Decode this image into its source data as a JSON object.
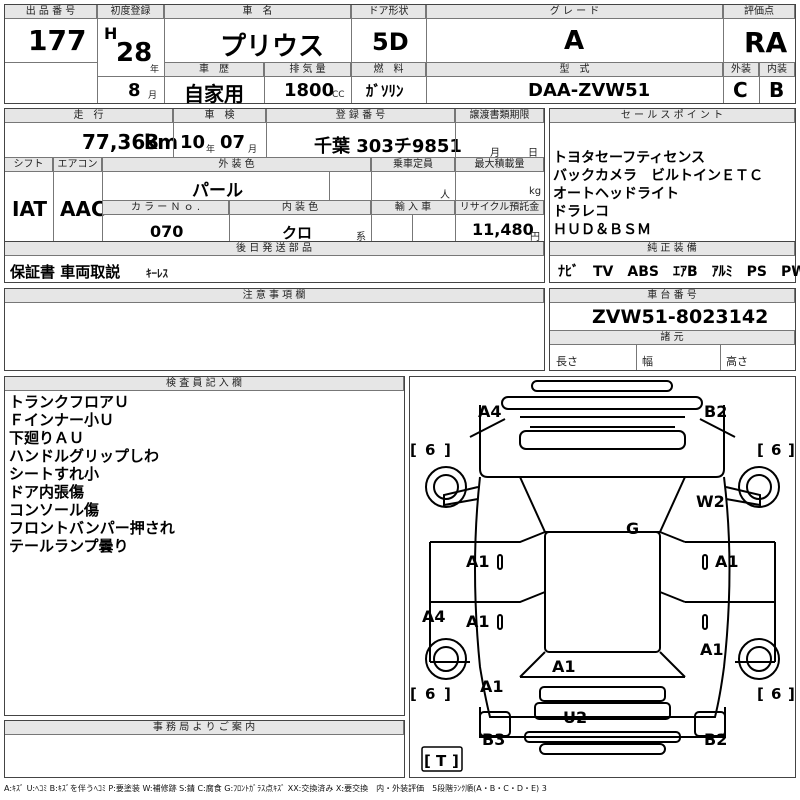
{
  "header": {
    "lot_no_label": "出 品 番 号",
    "lot_no": "177",
    "first_reg_label": "初度登録",
    "era": "H",
    "year": "28",
    "year_unit": "年",
    "month": "8",
    "month_unit": "月",
    "car_name_label": "車　名",
    "car_name": "プリウス",
    "door_label": "ドア形状",
    "door": "5D",
    "grade_label": "グ レ ー ド",
    "grade": "A",
    "score_label": "評価点",
    "score": "RA",
    "history_label": "車　歴",
    "history": "自家用",
    "displacement_label": "排 気 量",
    "displacement": "1800",
    "displacement_unit": "CC",
    "fuel_label": "燃　料",
    "fuel": "ｶﾞｿﾘﾝ",
    "model_label": "型　式",
    "model": "DAA-ZVW51",
    "exterior_label": "外装",
    "exterior": "C",
    "interior_label": "内装",
    "interior": "B"
  },
  "row2": {
    "mileage_label": "走　行",
    "mileage": "77,363",
    "mileage_unit": "km",
    "inspection_label": "車　検",
    "insp_year": "10",
    "insp_year_unit": "年",
    "insp_month": "07",
    "insp_month_unit": "月",
    "plate_label": "登 録 番 号",
    "plate": "千葉 303チ9851",
    "transfer_label": "譲渡書類期限",
    "transfer_month": "月",
    "transfer_day": "日",
    "shift_label": "シフト",
    "shift": "IAT",
    "ac_label": "エアコン",
    "ac": "AAC",
    "color_label": "外 装 色",
    "color": "パール",
    "capacity_label": "乗車定員",
    "capacity_unit": "人",
    "loadcap_label": "最大積載量",
    "loadcap_unit": "kg",
    "colorno_label": "カ ラ ー Ｎ ｏ .",
    "colorno": "070",
    "intcolor_label": "内 装 色",
    "intcolor": "クロ",
    "intcolor_unit": "系",
    "import_label": "輸 入 車",
    "recycle_label": "リサイクル預託金",
    "recycle": "11,480",
    "recycle_unit": "円"
  },
  "sales": {
    "label": "セ ー ル ス ポ イ ン ト",
    "lines": [
      "トヨタセーフティセンス",
      "バックカメラ　ビルトインＥＴＣ",
      "オートヘッドライト",
      "ドラレコ",
      "ＨＵＤ＆ＢＳＭ"
    ]
  },
  "later": {
    "label": "後 日 発 送 部 品",
    "items": "保証書 車両取説",
    "small": "ｷｰﾚｽ"
  },
  "equipment": {
    "label": "純 正 装 備",
    "items": "ﾅﾋﾞ　TV　ABS　ｴｱB　ｱﾙﾐ　PS　PW"
  },
  "notes": {
    "label": "注 意 事 項 欄"
  },
  "chassis": {
    "label": "車 台 番 号",
    "number": "ZVW51-8023142",
    "spec_label": "諸 元",
    "length": "長さ",
    "width": "幅",
    "height": "高さ"
  },
  "inspector": {
    "label": "検 査 員 記 入 欄",
    "lines": [
      "トランクフロアＵ",
      "Ｆインナー小Ｕ",
      "下廻りＡＵ",
      "ハンドルグリップしわ",
      "シートすれ小",
      "ドア内張傷",
      "コンソール傷",
      "フロントバンパー押され",
      "テールランプ曇り"
    ]
  },
  "office": {
    "label": "事 務 局 よ り ご 案 内"
  },
  "diagram": {
    "marks": {
      "a4_top": "A4",
      "b2_top": "B2",
      "w2": "W2",
      "g": "G",
      "a1_left_upper": "A1",
      "a1_right_upper": "A1",
      "a4_left": "A4",
      "a1_left_lower": "A1",
      "a1_right_lower": "A1",
      "a1_center": "A1",
      "a1_bottom_left": "A1",
      "u2": "U2",
      "b3": "B3",
      "b2_bottom": "B2"
    },
    "tire_lf": "6",
    "tire_rf": "6",
    "tire_lr": "6",
    "tire_rr": "6",
    "spare": "T"
  },
  "legend": "A:ｷｽﾞ U:ﾍｺﾐ B:ｷｽﾞを伴うﾍｺﾐ P:要塗装 W:補修跡 S:錆 C:腐食 G:ﾌﾛﾝﾄｶﾞﾗｽ点ｷｽﾞ XX:交換済み X:要交換　内・外装評価　5段階ﾗﾝｸ順(A・B・C・D・E) 3"
}
